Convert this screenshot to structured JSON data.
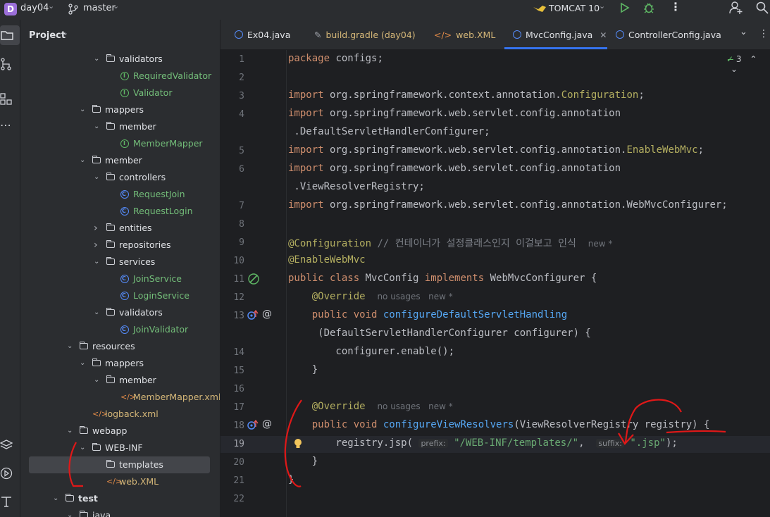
{
  "titlebar": {
    "project_badge": "D",
    "project_name": "day04",
    "vcs_icon": "branch-icon",
    "branch": "master",
    "run_config": "TOMCAT 10"
  },
  "left_toolbar": {
    "icons": [
      "folder-icon",
      "structure-icon",
      "plugins-icon",
      "more-icon",
      "layers-icon",
      "run-icon",
      "terminal-icon"
    ]
  },
  "project_panel": {
    "title": "Project",
    "tree": [
      {
        "label": "validators",
        "kind": "folder",
        "indent": 3,
        "expanded": true
      },
      {
        "label": "RequiredValidator",
        "kind": "interface",
        "indent": 4
      },
      {
        "label": "Validator",
        "kind": "interface",
        "indent": 4
      },
      {
        "label": "mappers",
        "kind": "folder",
        "indent": 2,
        "expanded": true
      },
      {
        "label": "member",
        "kind": "folder",
        "indent": 3,
        "expanded": true
      },
      {
        "label": "MemberMapper",
        "kind": "interface",
        "indent": 4
      },
      {
        "label": "member",
        "kind": "folder",
        "indent": 2,
        "expanded": true
      },
      {
        "label": "controllers",
        "kind": "folder",
        "indent": 3,
        "expanded": true
      },
      {
        "label": "RequestJoin",
        "kind": "class",
        "indent": 4
      },
      {
        "label": "RequestLogin",
        "kind": "class",
        "indent": 4
      },
      {
        "label": "entities",
        "kind": "folder",
        "indent": 3,
        "expanded": false
      },
      {
        "label": "repositories",
        "kind": "folder",
        "indent": 3,
        "expanded": false
      },
      {
        "label": "services",
        "kind": "folder",
        "indent": 3,
        "expanded": true
      },
      {
        "label": "JoinService",
        "kind": "class",
        "indent": 4
      },
      {
        "label": "LoginService",
        "kind": "class",
        "indent": 4
      },
      {
        "label": "validators",
        "kind": "folder",
        "indent": 3,
        "expanded": true
      },
      {
        "label": "JoinValidator",
        "kind": "class",
        "indent": 4
      },
      {
        "label": "resources",
        "kind": "folder",
        "indent": 1,
        "expanded": true
      },
      {
        "label": "mappers",
        "kind": "folder",
        "indent": 2,
        "expanded": true
      },
      {
        "label": "member",
        "kind": "folder",
        "indent": 3,
        "expanded": true
      },
      {
        "label": "MemberMapper.xml",
        "kind": "xml",
        "indent": 4
      },
      {
        "label": "logback.xml",
        "kind": "xml",
        "indent": 2
      },
      {
        "label": "webapp",
        "kind": "folder",
        "indent": 1,
        "expanded": true
      },
      {
        "label": "WEB-INF",
        "kind": "folder",
        "indent": 2,
        "expanded": true
      },
      {
        "label": "templates",
        "kind": "folder",
        "indent": 3,
        "selected": true
      },
      {
        "label": "web.XML",
        "kind": "xml",
        "indent": 3
      },
      {
        "label": "test",
        "kind": "folder",
        "indent": 0,
        "expanded": true
      },
      {
        "label": "java",
        "kind": "folder",
        "indent": 1,
        "expanded": true
      }
    ]
  },
  "tabs": [
    {
      "label": "Ex04.java",
      "active": false
    },
    {
      "label": "build.gradle (day04)",
      "active": false
    },
    {
      "label": "web.XML",
      "active": false
    },
    {
      "label": "MvcConfig.java",
      "active": true,
      "closable": true
    },
    {
      "label": "ControllerConfig.java",
      "active": false
    }
  ],
  "editor": {
    "problem_count": "3",
    "code_lines": [
      {
        "n": "1",
        "html": "<span class='kw'>package</span> configs;"
      },
      {
        "n": "2",
        "html": ""
      },
      {
        "n": "3",
        "html": "<span class='kw'>import</span> org.springframework.context.annotation.<span class='an'>Configuration</span>;"
      },
      {
        "n": "4",
        "html": "<span class='kw'>import</span> org.springframework.web.servlet.config.annotation"
      },
      {
        "n": "",
        "html": " .DefaultServletHandlerConfigurer;"
      },
      {
        "n": "5",
        "html": "<span class='kw'>import</span> org.springframework.web.servlet.config.annotation.<span class='an'>EnableWebMvc</span>;"
      },
      {
        "n": "6",
        "html": "<span class='kw'>import</span> org.springframework.web.servlet.config.annotation"
      },
      {
        "n": "",
        "html": " .ViewResolverRegistry;"
      },
      {
        "n": "7",
        "html": "<span class='kw'>import</span> org.springframework.web.servlet.config.annotation.WebMvcConfigurer;"
      },
      {
        "n": "8",
        "html": ""
      },
      {
        "n": "9",
        "html": "<span class='an'>@Configuration</span> <span class='cm'>// 컨테이너가 설정클래스인지 이걸보고 인식</span>  <span class='hint'>new *</span>"
      },
      {
        "n": "10",
        "html": "<span class='an'>@EnableWebMvc</span>"
      },
      {
        "n": "11",
        "html": "<span class='kw'>public class</span> MvcConfig <span class='kw'>implements</span> WebMvcConfigurer {"
      },
      {
        "n": "12",
        "html": "    <span class='an'>@Override</span>  <span class='hint'>no usages   new *</span>"
      },
      {
        "n": "13",
        "html": "    <span class='kw'>public void</span> <span class='fn'>configureDefaultServletHandling</span>"
      },
      {
        "n": "",
        "html": "     (DefaultServletHandlerConfigurer configurer) {"
      },
      {
        "n": "14",
        "html": "        configurer.enable();"
      },
      {
        "n": "15",
        "html": "    }"
      },
      {
        "n": "16",
        "html": ""
      },
      {
        "n": "17",
        "html": "    <span class='an'>@Override</span>  <span class='hint'>no usages   new *</span>"
      },
      {
        "n": "18",
        "html": "    <span class='kw'>public void</span> <span class='fn'>configureViewResolvers</span>(ViewResolverRegistry registry) {"
      },
      {
        "n": "19",
        "html": "        registry.jsp( <span class='inlay'>prefix:</span> <span class='str'>\"/WEB-INF/templates/\"</span>,  <span class='inlay'>suffix:</span> <span class='str'>\".jsp\"</span>);"
      },
      {
        "n": "20",
        "html": "    }"
      },
      {
        "n": "21",
        "html": "}"
      },
      {
        "n": "22",
        "html": ""
      }
    ]
  }
}
